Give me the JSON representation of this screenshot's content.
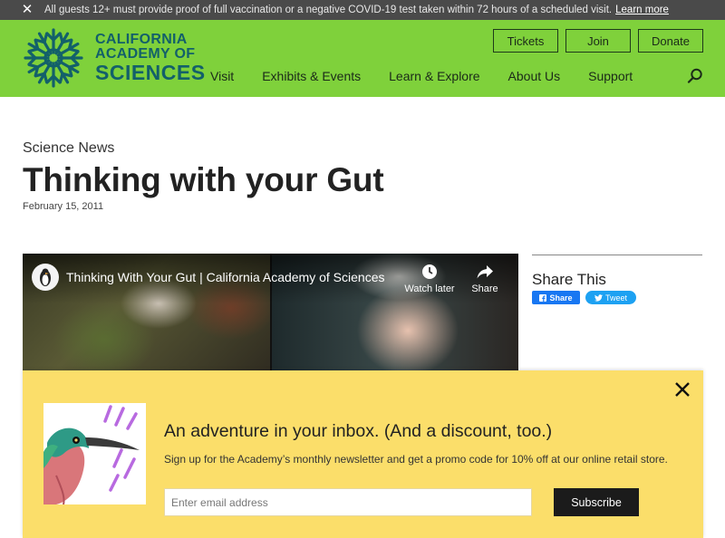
{
  "alert": {
    "close_icon": "close-icon",
    "message": "All guests 12+ must provide proof of full vaccination or a negative COVID-19 test taken within 72 hours of a scheduled visit.",
    "link": "Learn more"
  },
  "header": {
    "logo": {
      "line1": "CALIFORNIA",
      "line2": "ACADEMY OF",
      "line3": "SCIENCES"
    },
    "buttons": {
      "tickets": "Tickets",
      "join": "Join",
      "donate": "Donate"
    },
    "nav": [
      "Visit",
      "Exhibits & Events",
      "Learn & Explore",
      "About Us",
      "Support"
    ],
    "search_icon": "search-icon"
  },
  "article": {
    "section": "Science News",
    "title": "Thinking with your Gut",
    "date": "February 15, 2011"
  },
  "video": {
    "title": "Thinking With Your Gut | California Academy of Sciences",
    "watch_later": "Watch later",
    "share": "Share"
  },
  "share": {
    "title": "Share This",
    "facebook": "Share",
    "twitter": "Tweet"
  },
  "newsletter": {
    "heading": "An adventure in your inbox. (And a discount, too.)",
    "text": "Sign up for the Academy’s monthly newsletter and get a promo code for 10% off at our online retail store.",
    "placeholder": "Enter email address",
    "button": "Subscribe"
  },
  "colors": {
    "header_green": "#7fd13b",
    "logo_teal": "#13606a",
    "popup_yellow": "#fbde6a",
    "alert_gray": "#4a4a4a"
  }
}
